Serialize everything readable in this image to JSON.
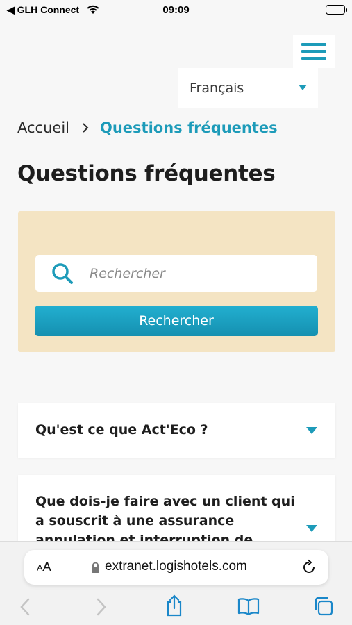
{
  "status_bar": {
    "back_app": "◀ GLH Connect",
    "time": "09:09"
  },
  "language": {
    "selected": "Français"
  },
  "breadcrumb": {
    "home": "Accueil",
    "current": "Questions fréquentes"
  },
  "page_title": "Questions fréquentes",
  "search": {
    "placeholder": "Rechercher",
    "button_label": "Rechercher"
  },
  "faq": [
    {
      "question": "Qu'est ce que Act'Eco ?"
    },
    {
      "question": "Que dois-je faire avec un client qui a souscrit à une assurance annulation et interruption de"
    }
  ],
  "browser": {
    "text_size_label": "AA",
    "url": "extranet.logishotels.com"
  },
  "colors": {
    "accent": "#1d9bb9",
    "panel": "#f4e4c3",
    "background": "#f7f7f7"
  }
}
